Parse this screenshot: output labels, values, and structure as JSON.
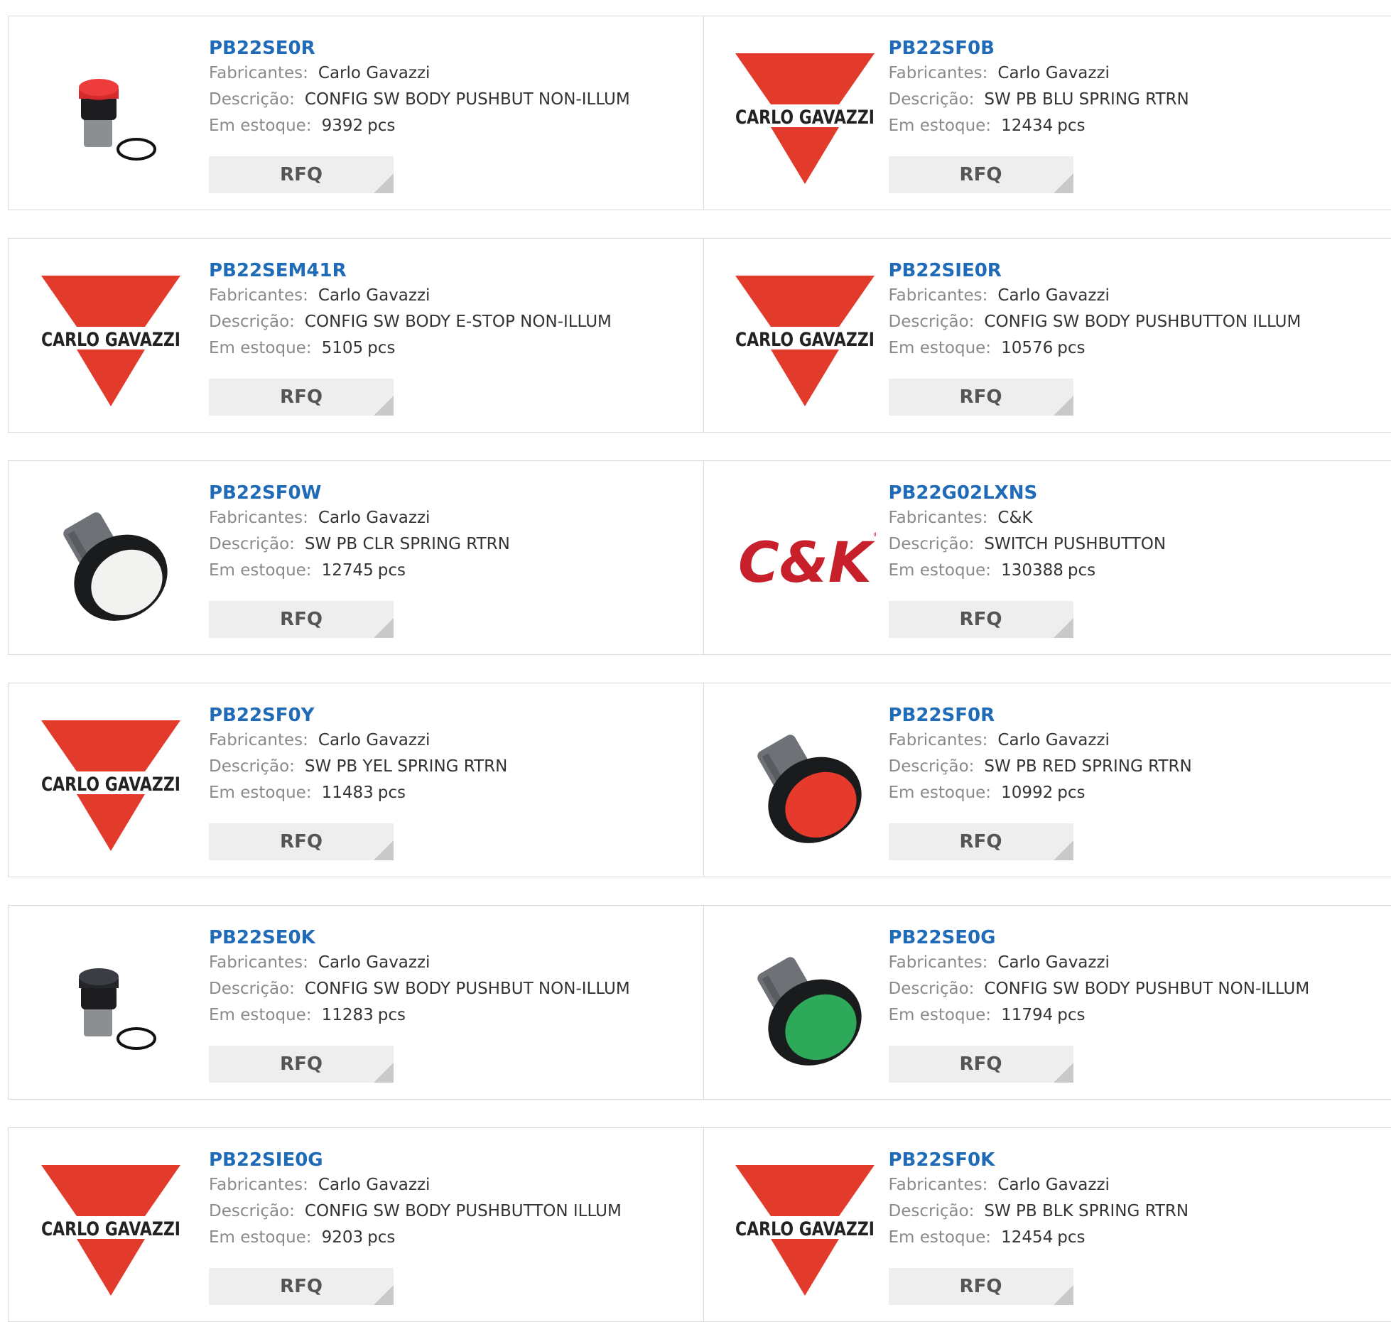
{
  "labels": {
    "manufacturer": "Fabricantes:",
    "description": "Descrição:",
    "stock": "Em estoque:",
    "stock_unit": "pcs",
    "rfq": "RFQ"
  },
  "colors": {
    "part_link": "#1f6bb8",
    "brand_red": "#e23a2b",
    "label_gray": "#8a8a8a",
    "value_text": "#333333",
    "button_bg": "#eeeeee"
  },
  "products": [
    {
      "part": "PB22SE0R",
      "manufacturer": "Carlo Gavazzi",
      "description": "CONFIG SW BODY PUSHBUT NON-ILLUM",
      "stock": "9392",
      "image": "pushbutton-red-small-icon"
    },
    {
      "part": "PB22SF0B",
      "manufacturer": "Carlo Gavazzi",
      "description": "SW PB BLU SPRING RTRN",
      "stock": "12434",
      "image": "carlo-gavazzi-logo"
    },
    {
      "part": "PB22SEM41R",
      "manufacturer": "Carlo Gavazzi",
      "description": "CONFIG SW BODY E-STOP NON-ILLUM",
      "stock": "5105",
      "image": "carlo-gavazzi-logo"
    },
    {
      "part": "PB22SIE0R",
      "manufacturer": "Carlo Gavazzi",
      "description": "CONFIG SW BODY PUSHBUTTON ILLUM",
      "stock": "10576",
      "image": "carlo-gavazzi-logo"
    },
    {
      "part": "PB22SF0W",
      "manufacturer": "Carlo Gavazzi",
      "description": "SW PB CLR SPRING RTRN",
      "stock": "12745",
      "image": "pushbutton-white-icon"
    },
    {
      "part": "PB22G02LXNS",
      "manufacturer": "C&K",
      "description": "SWITCH PUSHBUTTON",
      "stock": "130388",
      "image": "ck-logo"
    },
    {
      "part": "PB22SF0Y",
      "manufacturer": "Carlo Gavazzi",
      "description": "SW PB YEL SPRING RTRN",
      "stock": "11483",
      "image": "carlo-gavazzi-logo"
    },
    {
      "part": "PB22SF0R",
      "manufacturer": "Carlo Gavazzi",
      "description": "SW PB RED SPRING RTRN",
      "stock": "10992",
      "image": "pushbutton-red-icon"
    },
    {
      "part": "PB22SE0K",
      "manufacturer": "Carlo Gavazzi",
      "description": "CONFIG SW BODY PUSHBUT NON-ILLUM",
      "stock": "11283",
      "image": "pushbutton-black-small-icon"
    },
    {
      "part": "PB22SE0G",
      "manufacturer": "Carlo Gavazzi",
      "description": "CONFIG SW BODY PUSHBUT NON-ILLUM",
      "stock": "11794",
      "image": "pushbutton-green-icon"
    },
    {
      "part": "PB22SIE0G",
      "manufacturer": "Carlo Gavazzi",
      "description": "CONFIG SW BODY PUSHBUTTON ILLUM",
      "stock": "9203",
      "image": "carlo-gavazzi-logo"
    },
    {
      "part": "PB22SF0K",
      "manufacturer": "Carlo Gavazzi",
      "description": "SW PB BLK SPRING RTRN",
      "stock": "12454",
      "image": "carlo-gavazzi-logo"
    }
  ]
}
